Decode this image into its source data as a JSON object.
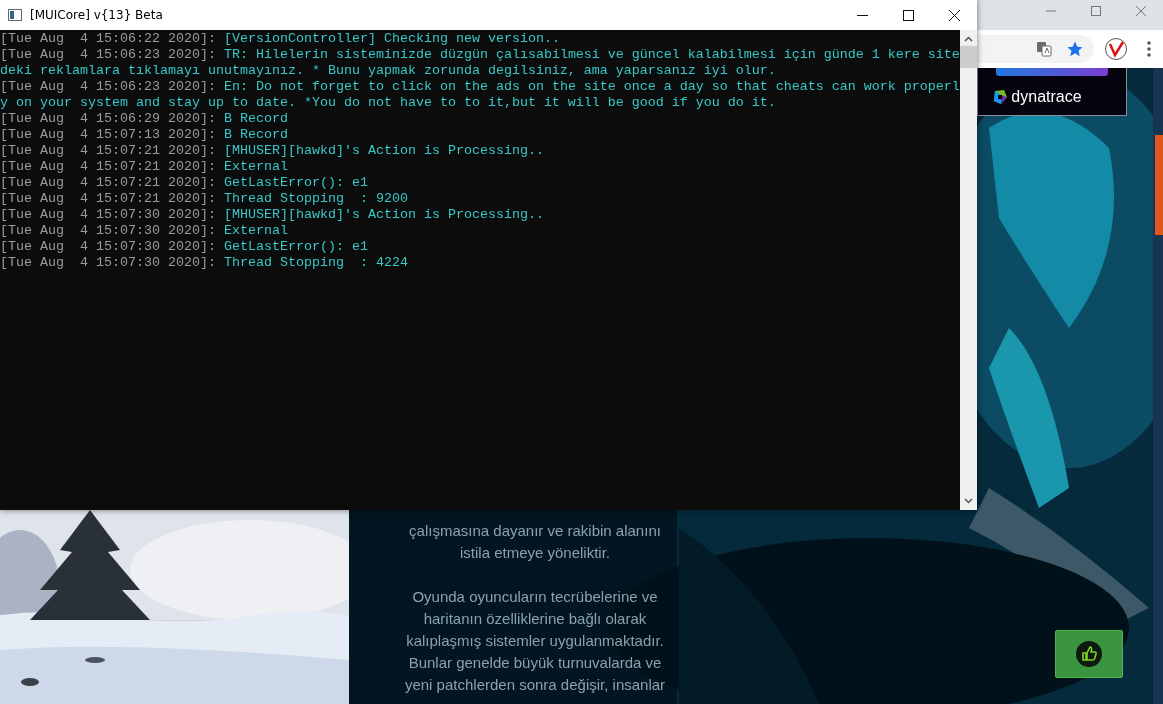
{
  "console": {
    "title": "[MUICore] v{13} Beta",
    "log": [
      {
        "time": "[Tue Aug  4 15:06:22 2020]:",
        "message": "[VersionController] Checking new version.."
      },
      {
        "time": "[Tue Aug  4 15:06:23 2020]:",
        "message": "TR: Hilelerin sisteminizde düzgün çalısabilmesi ve güncel kalabilmesi için günde 1 kere sitedeki reklamlara tıklamayı unutmayınız. * Bunu yapmak zorunda degilsiniz, ama yaparsanız iyi olur."
      },
      {
        "time": "[Tue Aug  4 15:06:23 2020]:",
        "message": "En: Do not forget to click on the ads on the site once a day so that cheats can work properly on your system and stay up to date. *You do not have to to it,but it will be good if you do it."
      },
      {
        "time": "[Tue Aug  4 15:06:29 2020]:",
        "message": "B Record"
      },
      {
        "time": "[Tue Aug  4 15:07:13 2020]:",
        "message": "B Record"
      },
      {
        "time": "[Tue Aug  4 15:07:21 2020]:",
        "message": "[MHUSER][hawkd]'s Action is Processing.."
      },
      {
        "time": "[Tue Aug  4 15:07:21 2020]:",
        "message": "External"
      },
      {
        "time": "[Tue Aug  4 15:07:21 2020]:",
        "message": "GetLastError(): e1"
      },
      {
        "time": "[Tue Aug  4 15:07:21 2020]:",
        "message": "Thread Stopping  : 9200"
      },
      {
        "time": "[Tue Aug  4 15:07:30 2020]:",
        "message": "[MHUSER][hawkd]'s Action is Processing.."
      },
      {
        "time": "[Tue Aug  4 15:07:30 2020]:",
        "message": "External"
      },
      {
        "time": "[Tue Aug  4 15:07:30 2020]:",
        "message": "GetLastError(): e1"
      },
      {
        "time": "[Tue Aug  4 15:07:30 2020]:",
        "message": "Thread Stopping  : 4224"
      }
    ]
  },
  "browser": {
    "ad": {
      "brand": "dynatrace"
    },
    "article": {
      "paragraphs": [
        "çalışmasına dayanır ve rakibin alanını istila etmeye yöneliktir.",
        "Oyunda oyuncuların tecrübelerine ve haritanın özelliklerine bağlı olarak kalıplaşmış sistemler uygulanmaktadır. Bunlar genelde büyük turnuvalarda ve yeni patchlerden sonra değişir, insanlar"
      ]
    }
  }
}
